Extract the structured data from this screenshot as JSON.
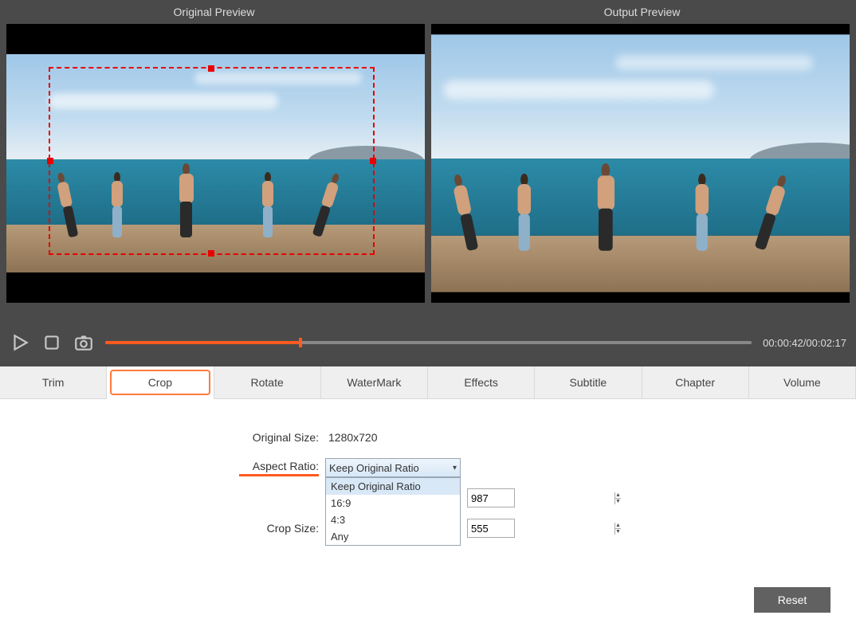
{
  "preview": {
    "original_label": "Original Preview",
    "output_label": "Output Preview"
  },
  "playback": {
    "current_time": "00:00:42",
    "total_time": "00:02:17",
    "timecode": "00:00:42/00:02:17",
    "progress_pct": 30
  },
  "tabs": [
    "Trim",
    "Crop",
    "Rotate",
    "WaterMark",
    "Effects",
    "Subtitle",
    "Chapter",
    "Volume"
  ],
  "active_tab_index": 1,
  "crop": {
    "original_label": "Original Size:",
    "original_value": "1280x720",
    "aspect_label": "Aspect Ratio:",
    "aspect_selected": "Keep Original Ratio",
    "aspect_options": [
      "Keep Original Ratio",
      "16:9",
      "4:3",
      "Any"
    ],
    "size_label": "Crop Size:",
    "width": "987",
    "height": "555"
  },
  "buttons": {
    "reset": "Reset"
  },
  "icons": {
    "play": "play-icon",
    "stop": "stop-icon",
    "snapshot": "camera-icon"
  }
}
